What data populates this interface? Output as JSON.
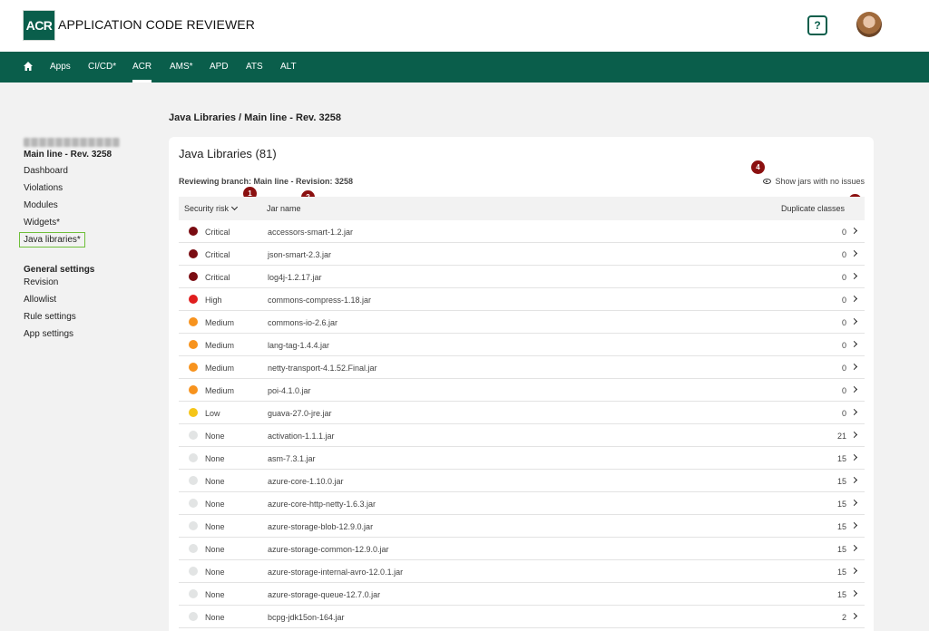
{
  "header": {
    "logo_text": "ACR",
    "app_title": "APPLICATION CODE REVIEWER",
    "help_label": "?"
  },
  "nav": {
    "items": [
      {
        "label": "Apps"
      },
      {
        "label": "CI/CD*"
      },
      {
        "label": "ACR",
        "active": true
      },
      {
        "label": "AMS*"
      },
      {
        "label": "APD"
      },
      {
        "label": "ATS"
      },
      {
        "label": "ALT"
      }
    ]
  },
  "page": {
    "breadcrumb_title": "Java Libraries / Main line - Rev. 3258"
  },
  "sidebar": {
    "branch": "Main line - Rev. 3258",
    "items": [
      {
        "label": "Dashboard"
      },
      {
        "label": "Violations"
      },
      {
        "label": "Modules"
      },
      {
        "label": "Widgets*"
      },
      {
        "label": "Java libraries*",
        "selected": true
      }
    ],
    "general_heading": "General settings",
    "general_items": [
      {
        "label": "Revision"
      },
      {
        "label": "Allowlist"
      },
      {
        "label": "Rule settings"
      },
      {
        "label": "App settings"
      }
    ]
  },
  "card": {
    "title": "Java Libraries (81)",
    "branch_text": "Reviewing branch: Main line - Revision: 3258",
    "show_jars_label": "Show jars with no issues"
  },
  "badges": [
    "1",
    "2",
    "3",
    "4"
  ],
  "table": {
    "headers": {
      "security_risk": "Security risk",
      "jar_name": "Jar name",
      "duplicate_classes": "Duplicate classes"
    },
    "risk_colors": {
      "Critical": "#7a0c12",
      "High": "#e01e1e",
      "Medium": "#f7931e",
      "Low": "#f5c518",
      "None": "#e2e4e4"
    },
    "rows": [
      {
        "risk": "Critical",
        "jar": "accessors-smart-1.2.jar",
        "dup": "0"
      },
      {
        "risk": "Critical",
        "jar": "json-smart-2.3.jar",
        "dup": "0"
      },
      {
        "risk": "Critical",
        "jar": "log4j-1.2.17.jar",
        "dup": "0"
      },
      {
        "risk": "High",
        "jar": "commons-compress-1.18.jar",
        "dup": "0"
      },
      {
        "risk": "Medium",
        "jar": "commons-io-2.6.jar",
        "dup": "0"
      },
      {
        "risk": "Medium",
        "jar": "lang-tag-1.4.4.jar",
        "dup": "0"
      },
      {
        "risk": "Medium",
        "jar": "netty-transport-4.1.52.Final.jar",
        "dup": "0"
      },
      {
        "risk": "Medium",
        "jar": "poi-4.1.0.jar",
        "dup": "0"
      },
      {
        "risk": "Low",
        "jar": "guava-27.0-jre.jar",
        "dup": "0"
      },
      {
        "risk": "None",
        "jar": "activation-1.1.1.jar",
        "dup": "21"
      },
      {
        "risk": "None",
        "jar": "asm-7.3.1.jar",
        "dup": "15"
      },
      {
        "risk": "None",
        "jar": "azure-core-1.10.0.jar",
        "dup": "15"
      },
      {
        "risk": "None",
        "jar": "azure-core-http-netty-1.6.3.jar",
        "dup": "15"
      },
      {
        "risk": "None",
        "jar": "azure-storage-blob-12.9.0.jar",
        "dup": "15"
      },
      {
        "risk": "None",
        "jar": "azure-storage-common-12.9.0.jar",
        "dup": "15"
      },
      {
        "risk": "None",
        "jar": "azure-storage-internal-avro-12.0.1.jar",
        "dup": "15"
      },
      {
        "risk": "None",
        "jar": "azure-storage-queue-12.7.0.jar",
        "dup": "15"
      },
      {
        "risk": "None",
        "jar": "bcpg-jdk15on-164.jar",
        "dup": "2"
      }
    ]
  }
}
